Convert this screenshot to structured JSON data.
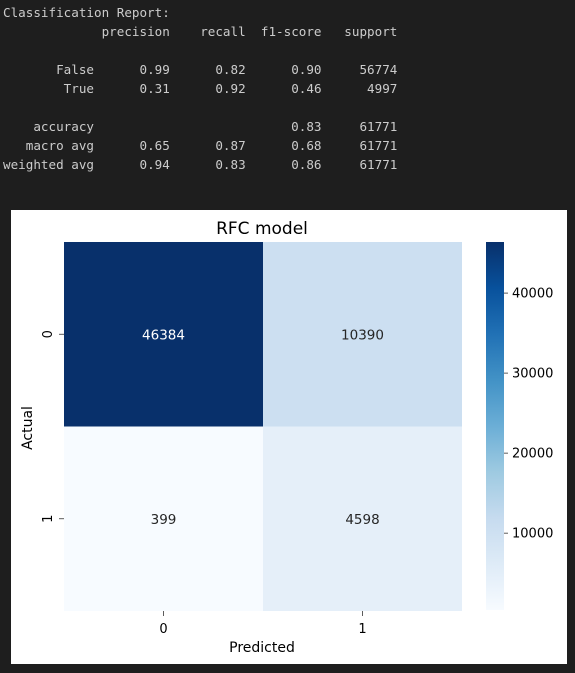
{
  "report": {
    "title": "Classification Report:",
    "header": [
      "precision",
      "recall",
      "f1-score",
      "support"
    ],
    "rows": [
      {
        "label": "False",
        "precision": "0.99",
        "recall": "0.82",
        "f1": "0.90",
        "support": "56774"
      },
      {
        "label": "True",
        "precision": "0.31",
        "recall": "0.92",
        "f1": "0.46",
        "support": "4997"
      }
    ],
    "summary": [
      {
        "label": "accuracy",
        "precision": "",
        "recall": "",
        "f1": "0.83",
        "support": "61771"
      },
      {
        "label": "macro avg",
        "precision": "0.65",
        "recall": "0.87",
        "f1": "0.68",
        "support": "61771"
      },
      {
        "label": "weighted avg",
        "precision": "0.94",
        "recall": "0.83",
        "f1": "0.86",
        "support": "61771"
      }
    ]
  },
  "chart_data": {
    "type": "heatmap",
    "title": "RFC model",
    "xlabel": "Predicted",
    "ylabel": "Actual",
    "x_ticks": [
      "0",
      "1"
    ],
    "y_ticks": [
      "0",
      "1"
    ],
    "matrix": [
      [
        46384,
        10390
      ],
      [
        399,
        4598
      ]
    ],
    "colorbar": {
      "ticks": [
        10000,
        20000,
        30000,
        40000
      ],
      "min": 399,
      "max": 46384
    },
    "colormap": "Blues",
    "colors": {
      "low": "#f7fbff",
      "high": "#08306b"
    }
  }
}
